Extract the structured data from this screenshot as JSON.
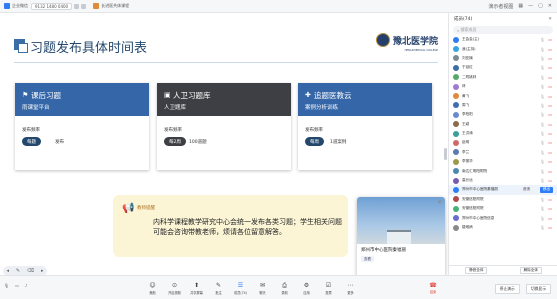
{
  "topbar": {
    "app_name": "企业微信",
    "meeting_id": "9132 1480 0400",
    "presenter": "长进医共体课程",
    "right_label": "演示者视图",
    "icons": [
      "clock-icon",
      "signal-icon",
      "mic-icon",
      "share-icon",
      "settings-icon",
      "close-icon"
    ]
  },
  "slide": {
    "title": "习题发布具体时间表",
    "brand_name": "豫北医学院",
    "brand_sub": "HENAN MEDICAL COLLEGE",
    "cards": [
      {
        "icon": "⚑",
        "title": "课后习题",
        "subtitle": "雨课堂平台",
        "label": "发布频率",
        "pill": "每题",
        "value": "发布",
        "style": "blue"
      },
      {
        "icon": "▣",
        "title": "人卫习题库",
        "subtitle": "人卫题库",
        "label": "发布频率",
        "pill": "每2周",
        "value": "100道题",
        "style": "dark"
      },
      {
        "icon": "✚",
        "title": "追题医教云",
        "subtitle": "案例分析训练",
        "label": "发布频率",
        "pill": "每周",
        "value": "1道案例",
        "style": "blue"
      }
    ],
    "notice": {
      "heading": "教师提醒",
      "text": "内科学课程教学研究中心会统一发布各类习题；学生相关问题可能会咨询带教老师，烦请各位留意解答。"
    }
  },
  "popup": {
    "caption": "郑州市中心医院秦福丽",
    "button": "查看"
  },
  "sidebar": {
    "title": "成员(74)",
    "search_placeholder": "搜索成员",
    "members": [
      {
        "name": "王会会(主)",
        "color": "#2f7df6"
      },
      {
        "name": "我(主持)",
        "color": "#36a4e0"
      },
      {
        "name": "刘亚楠",
        "color": "#7c8a96"
      },
      {
        "name": "于延红",
        "color": "#3a6ea5"
      },
      {
        "name": "二附姚林",
        "color": "#56a86b"
      },
      {
        "name": "林",
        "color": "#a07ad0"
      },
      {
        "name": "黄飞",
        "color": "#e08a3a"
      },
      {
        "name": "周飞",
        "color": "#3d6fb0"
      },
      {
        "name": "李柏阳",
        "color": "#6a8ad0"
      },
      {
        "name": "王颖",
        "color": "#8c6a4a"
      },
      {
        "name": "王洪涛",
        "color": "#3a9e9e"
      },
      {
        "name": "赵明",
        "color": "#d06a6a"
      },
      {
        "name": "李兰",
        "color": "#5a7ab0"
      },
      {
        "name": "李丽华",
        "color": "#9a9a4a"
      },
      {
        "name": "南达汇明阳附院",
        "color": "#4a8ab0"
      },
      {
        "name": "高长远",
        "color": "#7a5ab0"
      },
      {
        "name": "郑州市中心医院秦福丽",
        "color": "#2f7df6",
        "highlight": true,
        "btn_a": "邀请",
        "btn_b": "移出"
      },
      {
        "name": "安徽信阳附院",
        "color": "#b04a4a"
      },
      {
        "name": "安徽信阳附院",
        "color": "#4ab07a"
      },
      {
        "name": "郑州市中心医院信息",
        "color": "#6a6ad0"
      },
      {
        "name": "疑难病",
        "color": "#8a8a8a"
      }
    ],
    "footer": [
      "静音全体",
      "解除全体"
    ]
  },
  "bottombar": {
    "left_icons": [
      "mic-icon",
      "camera-icon",
      "speaker-icon"
    ],
    "tools": [
      {
        "icon": "☺",
        "label": "美颜",
        "name": "beauty"
      },
      {
        "icon": "⊙",
        "label": "开启视频",
        "name": "video"
      },
      {
        "icon": "⬆",
        "label": "共享屏幕",
        "name": "share"
      },
      {
        "icon": "✎",
        "label": "批注",
        "name": "annotate"
      },
      {
        "icon": "☰",
        "label": "成员(74)",
        "name": "members",
        "on": true
      },
      {
        "icon": "✉",
        "label": "聊天",
        "name": "chat"
      },
      {
        "icon": "⎙",
        "label": "录制",
        "name": "record"
      },
      {
        "icon": "⚙",
        "label": "应用",
        "name": "apps"
      },
      {
        "icon": "☑",
        "label": "投票",
        "name": "vote"
      },
      {
        "icon": "⋯",
        "label": "更多",
        "name": "more"
      }
    ],
    "end_label": "结束",
    "right": [
      "停止演示",
      "切换显示"
    ]
  }
}
